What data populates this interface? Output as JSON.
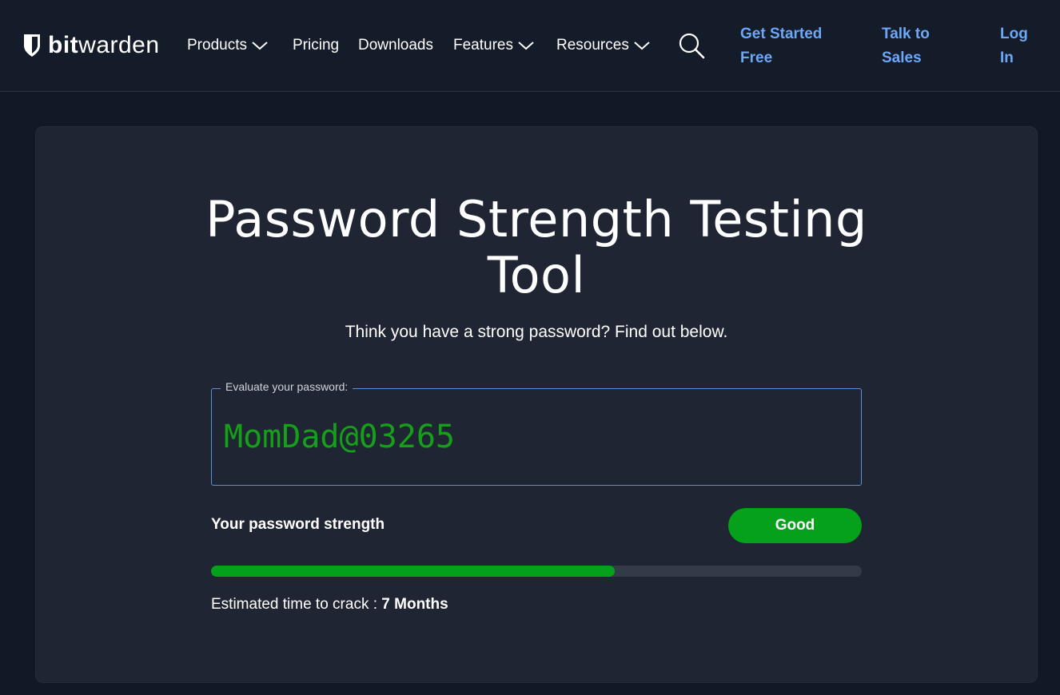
{
  "brand": {
    "bold": "bit",
    "regular": "warden",
    "icon": "shield-icon"
  },
  "nav": {
    "items": [
      {
        "label": "Products",
        "has_dropdown": true
      },
      {
        "label": "Pricing",
        "has_dropdown": false
      },
      {
        "label": "Downloads",
        "has_dropdown": false
      },
      {
        "label": "Features",
        "has_dropdown": true
      },
      {
        "label": "Resources",
        "has_dropdown": true
      }
    ],
    "search_icon": "search-icon",
    "cta": [
      {
        "line1": "Get Started",
        "line2": "Free"
      },
      {
        "line1": "Talk to",
        "line2": "Sales"
      },
      {
        "line1": "Log",
        "line2": "In"
      }
    ]
  },
  "main": {
    "title_line1": "Password Strength Testing",
    "title_line2": "Tool",
    "subtitle": "Think you have a strong password? Find out below.",
    "field_label": "Evaluate your password:",
    "password_value": "MomDad@03265",
    "strength_label": "Your password strength",
    "strength_badge": "Good",
    "strength_progress_percent": 62,
    "crack_prefix": "Estimated time to crack : ",
    "crack_value": "7 Months"
  },
  "colors": {
    "background": "#121826",
    "card": "#1f2532",
    "link": "#6da7f7",
    "accent_green": "#05a11a",
    "password_text": "#16a01a"
  }
}
